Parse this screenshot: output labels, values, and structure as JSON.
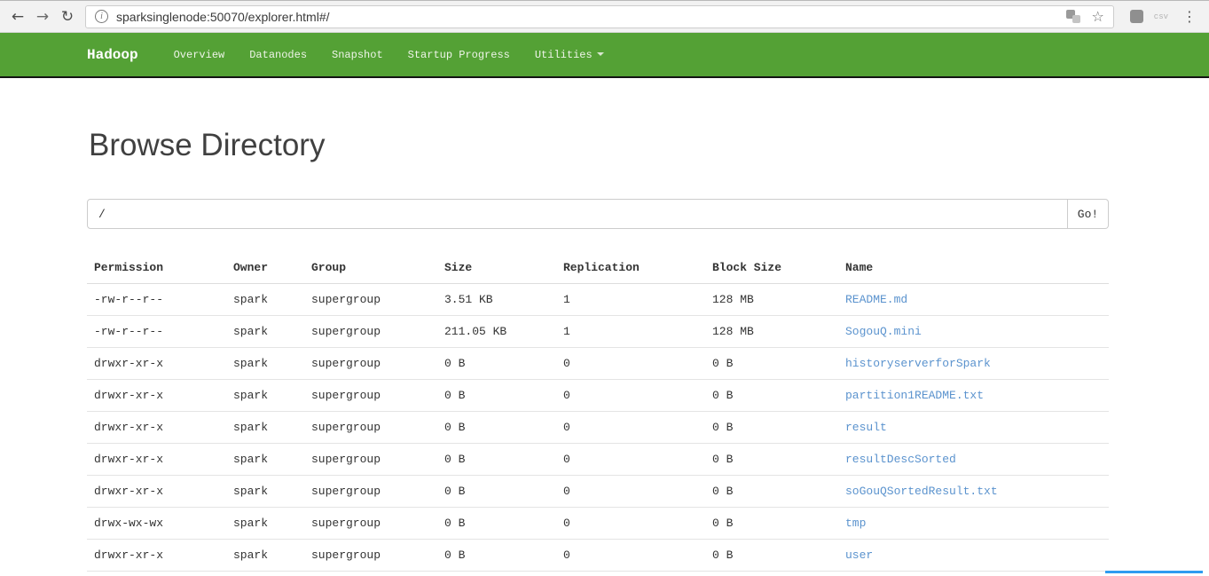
{
  "browser": {
    "url": "sparksinglenode:50070/explorer.html#/",
    "extension_label": "csv"
  },
  "navbar": {
    "brand": "Hadoop",
    "items": [
      {
        "label": "Overview"
      },
      {
        "label": "Datanodes"
      },
      {
        "label": "Snapshot"
      },
      {
        "label": "Startup Progress"
      },
      {
        "label": "Utilities"
      }
    ]
  },
  "page": {
    "title": "Browse Directory",
    "path_value": "/",
    "go_label": "Go!"
  },
  "table": {
    "columns": [
      "Permission",
      "Owner",
      "Group",
      "Size",
      "Replication",
      "Block Size",
      "Name"
    ],
    "rows": [
      [
        "-rw-r--r--",
        "spark",
        "supergroup",
        "3.51 KB",
        "1",
        "128 MB",
        "README.md"
      ],
      [
        "-rw-r--r--",
        "spark",
        "supergroup",
        "211.05 KB",
        "1",
        "128 MB",
        "SogouQ.mini"
      ],
      [
        "drwxr-xr-x",
        "spark",
        "supergroup",
        "0 B",
        "0",
        "0 B",
        "historyserverforSpark"
      ],
      [
        "drwxr-xr-x",
        "spark",
        "supergroup",
        "0 B",
        "0",
        "0 B",
        "partition1README.txt"
      ],
      [
        "drwxr-xr-x",
        "spark",
        "supergroup",
        "0 B",
        "0",
        "0 B",
        "result"
      ],
      [
        "drwxr-xr-x",
        "spark",
        "supergroup",
        "0 B",
        "0",
        "0 B",
        "resultDescSorted"
      ],
      [
        "drwxr-xr-x",
        "spark",
        "supergroup",
        "0 B",
        "0",
        "0 B",
        "soGouQSortedResult.txt"
      ],
      [
        "drwx-wx-wx",
        "spark",
        "supergroup",
        "0 B",
        "0",
        "0 B",
        "tmp"
      ],
      [
        "drwxr-xr-x",
        "spark",
        "supergroup",
        "0 B",
        "0",
        "0 B",
        "user"
      ]
    ]
  },
  "colors": {
    "navbar_green": "#54A135",
    "link_blue": "#5b93ce",
    "accent_blue_line": "#2e9bf0"
  }
}
